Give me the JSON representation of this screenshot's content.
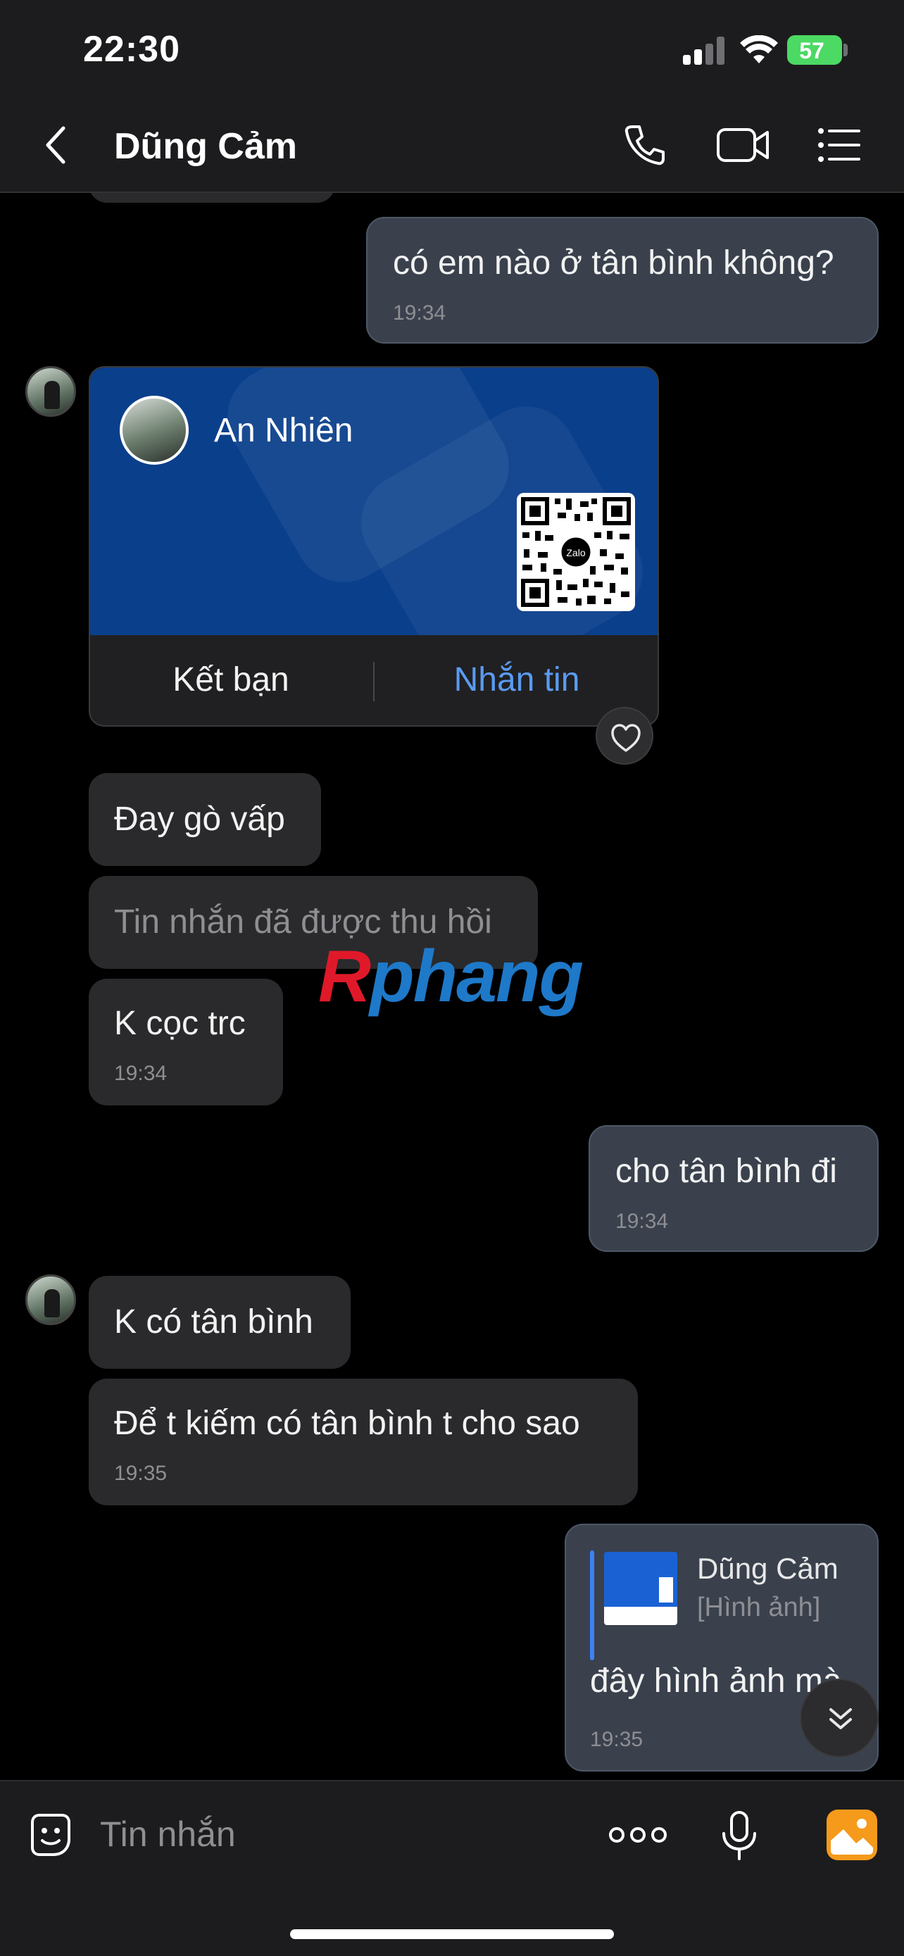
{
  "status": {
    "time": "22:30",
    "battery": "57"
  },
  "header": {
    "title": "Dũng Cảm",
    "icons": [
      "back-icon",
      "phone-icon",
      "video-icon",
      "menu-icon"
    ]
  },
  "messages": {
    "m1": {
      "text": "có em nào ở tân bình không?",
      "time": "19:34"
    },
    "card": {
      "name": "An Nhiên",
      "add_friend": "Kết bạn",
      "message": "Nhắn tin",
      "qr_label": "Zalo"
    },
    "m2": {
      "text": "Đay gò vấp"
    },
    "m3": {
      "text": "Tin nhắn đã được thu hồi"
    },
    "m4": {
      "text": "K cọc trc",
      "time": "19:34"
    },
    "m5": {
      "text": "cho tân bình đi",
      "time": "19:34"
    },
    "m6": {
      "text": "K có tân bình"
    },
    "m7": {
      "text": "Để t kiếm có tân bình t cho sao",
      "time": "19:35"
    },
    "m8": {
      "reply_name": "Dũng Cảm",
      "reply_type": "[Hình ảnh]",
      "text": "đây hình ảnh mà",
      "time": "19:35"
    }
  },
  "watermark": {
    "part1": "R",
    "part2": "phang"
  },
  "input": {
    "placeholder": "Tin nhắn",
    "icons": [
      "sticker-icon",
      "more-icon",
      "mic-icon",
      "gallery-icon"
    ]
  },
  "colors": {
    "accent": "#5a9bf0",
    "outgoing": "#3a414d",
    "incoming": "#2a2a2c",
    "card": "#0a3f8c"
  }
}
